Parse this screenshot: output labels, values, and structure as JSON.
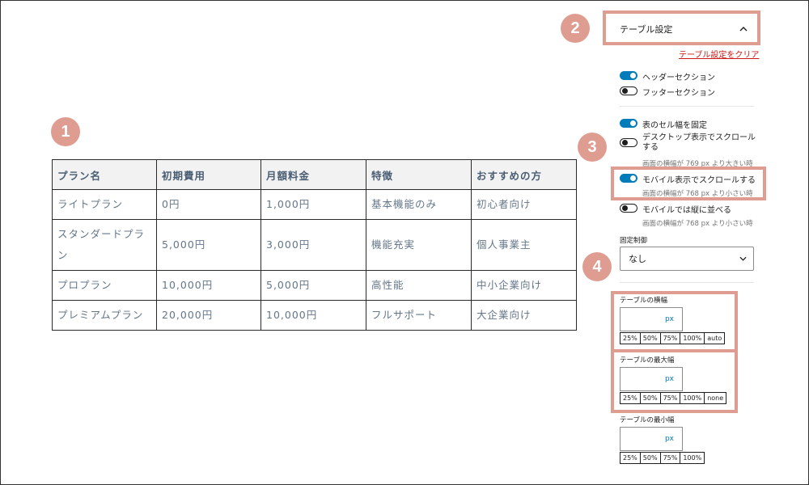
{
  "markers": [
    "1",
    "2",
    "3",
    "4"
  ],
  "table": {
    "headers": [
      "プラン名",
      "初期費用",
      "月額料金",
      "特徴",
      "おすすめの方"
    ],
    "rows": [
      [
        "ライトプラン",
        "0円",
        "1,000円",
        "基本機能のみ",
        "初心者向け"
      ],
      [
        "スタンダードプラン",
        "5,000円",
        "3,000円",
        "機能充実",
        "個人事業主"
      ],
      [
        "プロプラン",
        "10,000円",
        "5,000円",
        "高性能",
        "中小企業向け"
      ],
      [
        "プレミアムプラン",
        "20,000円",
        "10,000円",
        "フルサポート",
        "大企業向け"
      ]
    ]
  },
  "settings": {
    "panel_title": "テーブル設定",
    "chevron_icon": "chevron-up-icon",
    "clear_link": "テーブル設定をクリア",
    "toggles": {
      "header": {
        "label": "ヘッダーセクション",
        "on": true
      },
      "footer": {
        "label": "フッターセクション",
        "on": false
      },
      "fixed_cell_width": {
        "label": "表のセル幅を固定",
        "on": true
      },
      "desktop_scroll": {
        "label_line1": "デスクトップ表示でスクロール",
        "label_line2": "する",
        "help": "画面の横幅が 769 px より大きい時",
        "on": false
      },
      "mobile_scroll": {
        "label": "モバイル表示でスクロールする",
        "help": "画面の横幅が 768 px より小さい時",
        "on": true
      },
      "mobile_stack": {
        "label": "モバイルでは縦に並べる",
        "help": "画面の横幅が 768 px より小さい時",
        "on": false
      }
    },
    "fixed_control": {
      "label": "固定制御",
      "value": "なし"
    },
    "width": {
      "label": "テーブルの横幅",
      "unit": "px",
      "options": [
        "25%",
        "50%",
        "75%",
        "100%",
        "auto"
      ]
    },
    "max_width": {
      "label": "テーブルの最大幅",
      "unit": "px",
      "options": [
        "25%",
        "50%",
        "75%",
        "100%",
        "none"
      ]
    },
    "min_width": {
      "label": "テーブルの最小幅",
      "unit": "px",
      "options": [
        "25%",
        "50%",
        "75%",
        "100%"
      ]
    }
  },
  "colors": {
    "accent": "#007cba",
    "highlight": "#df9c90",
    "link": "#cc1818"
  }
}
